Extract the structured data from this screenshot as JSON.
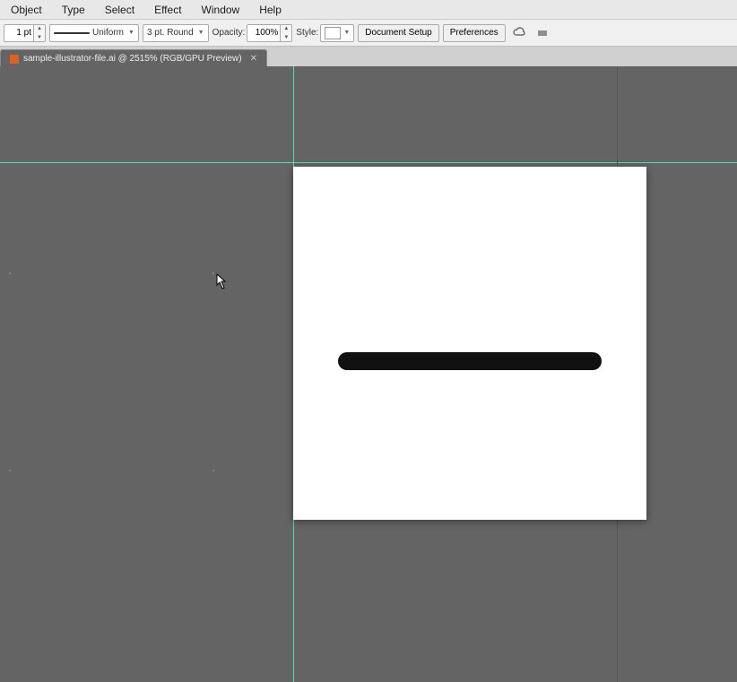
{
  "menubar": {
    "items": [
      "Object",
      "Type",
      "Select",
      "Effect",
      "Window",
      "Help"
    ]
  },
  "toolbar": {
    "stroke_width": "1 pt",
    "stroke_style": "Uniform",
    "stroke_points": "3 pt. Round",
    "opacity_label": "Opacity:",
    "opacity_value": "100%",
    "style_label": "Style:",
    "doc_setup_label": "Document Setup",
    "preferences_label": "Preferences"
  },
  "tabbar": {
    "doc_name": "sample-illustrator-file.ai @ 2515% (RGB/GPU Preview)"
  },
  "canvas": {
    "background_color": "#646464"
  }
}
